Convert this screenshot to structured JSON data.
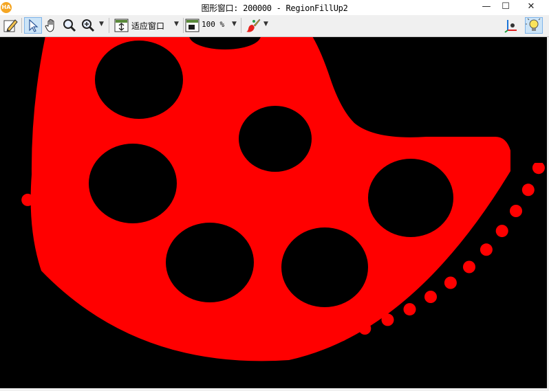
{
  "window": {
    "title": "图形窗口: 200000 - RegionFillUp2",
    "logo_text": "HA",
    "minimize_glyph": "—",
    "maximize_glyph": "☐",
    "close_glyph": "✕"
  },
  "toolbar": {
    "fit_label": "适应窗口",
    "zoom_label": "100 %",
    "dropdown_glyph": "▼"
  },
  "icons": [
    "pencil-edit-icon",
    "pointer-arrow-icon",
    "hand-pan-icon",
    "magnifier-icon",
    "zoom-in-icon",
    "fit-window-icon",
    "zoom-percent-icon",
    "paint-brush-icon",
    "3d-axes-icon",
    "lightbulb-icon"
  ],
  "colors": {
    "region": "#ff0000",
    "background": "#000000",
    "selected_tool": "#cce4f7"
  }
}
